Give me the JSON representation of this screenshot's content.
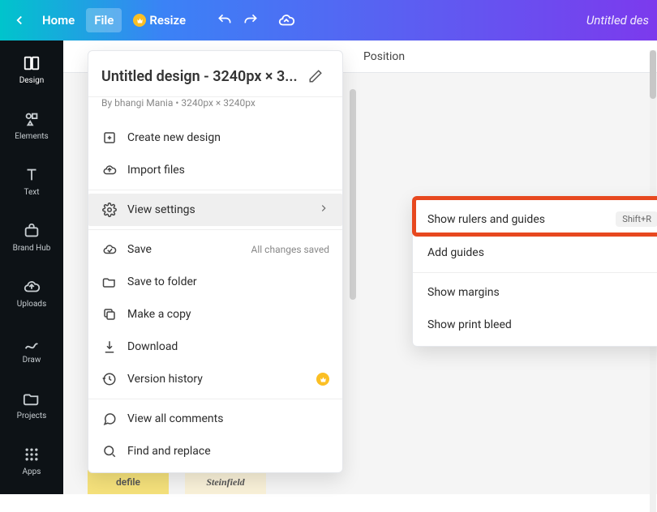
{
  "topbar": {
    "home": "Home",
    "file": "File",
    "resize": "Resize",
    "project_name": "Untitled des"
  },
  "sidebar": {
    "items": [
      {
        "label": "Design"
      },
      {
        "label": "Elements"
      },
      {
        "label": "Text"
      },
      {
        "label": "Brand Hub"
      },
      {
        "label": "Uploads"
      },
      {
        "label": "Draw"
      },
      {
        "label": "Projects"
      },
      {
        "label": "Apps"
      }
    ]
  },
  "secondary": {
    "position": "Position"
  },
  "panel": {
    "title": "Untitled design - 3240px × 3...",
    "subtitle": "By bhangi Mania • 3240px × 3240px",
    "items": {
      "create": "Create new design",
      "import": "Import files",
      "view_settings": "View settings",
      "save": "Save",
      "save_status": "All changes saved",
      "save_folder": "Save to folder",
      "copy": "Make a copy",
      "download": "Download",
      "version": "Version history",
      "comments": "View all comments",
      "find": "Find and replace"
    }
  },
  "submenu": {
    "rulers": "Show rulers and guides",
    "rulers_shortcut": "Shift+R",
    "add_guides": "Add guides",
    "margins": "Show margins",
    "print_bleed": "Show print bleed"
  },
  "thumbs": {
    "t1": "defile",
    "t2": "Steinfield"
  }
}
